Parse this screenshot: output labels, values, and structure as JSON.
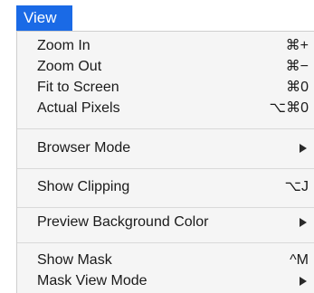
{
  "menubar": {
    "view_label": "View"
  },
  "menu": {
    "zoom_in": {
      "label": "Zoom In",
      "shortcut": "⌘+"
    },
    "zoom_out": {
      "label": "Zoom Out",
      "shortcut": "⌘−"
    },
    "fit_to_screen": {
      "label": "Fit to Screen",
      "shortcut": "⌘0"
    },
    "actual_pixels": {
      "label": "Actual Pixels",
      "shortcut": "⌥⌘0"
    },
    "browser_mode": {
      "label": "Browser Mode"
    },
    "show_clipping": {
      "label": "Show Clipping",
      "shortcut": "⌥J"
    },
    "preview_bg_color": {
      "label": "Preview Background Color"
    },
    "show_mask": {
      "label": "Show Mask",
      "shortcut": "^M"
    },
    "mask_view_mode": {
      "label": "Mask View Mode"
    }
  },
  "icons": {
    "submenu_arrow": "submenu-arrow-icon"
  }
}
